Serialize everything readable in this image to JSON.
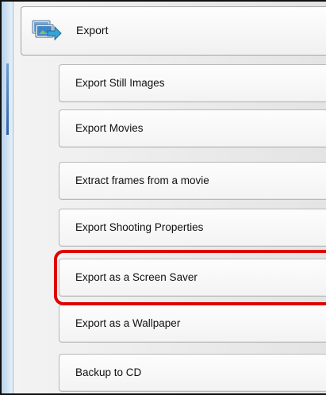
{
  "export_menu": {
    "parent": {
      "label": "Export",
      "icon": "export-icon"
    },
    "items": [
      {
        "label": "Export Still Images"
      },
      {
        "label": "Export Movies"
      },
      {
        "label": "Extract frames from a movie"
      },
      {
        "label": "Export Shooting Properties"
      },
      {
        "label": "Export as a Screen Saver"
      },
      {
        "label": "Export as a Wallpaper"
      },
      {
        "label": "Backup to CD"
      }
    ]
  },
  "annotation": {
    "highlighted_item": "Export as a Screen Saver",
    "color": "#e00000"
  },
  "colors": {
    "panel": "#ececec",
    "item_border": "#b9b9b9",
    "left_bar": "#b8d3ea"
  }
}
